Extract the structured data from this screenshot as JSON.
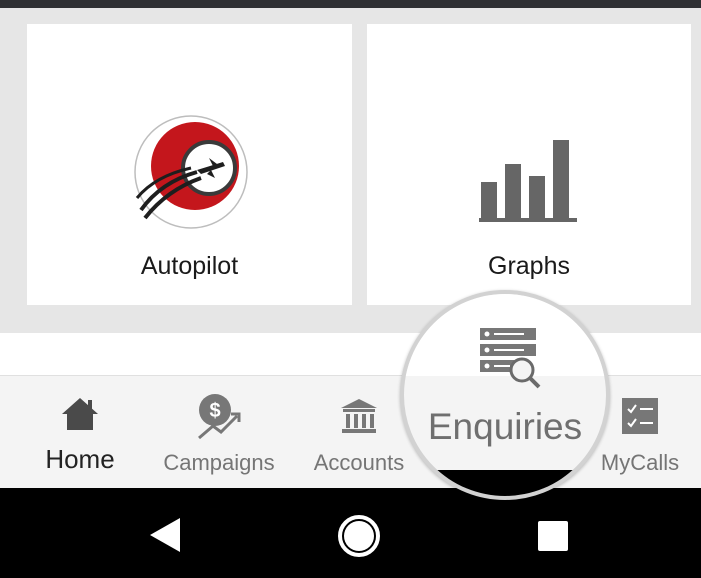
{
  "tiles": [
    {
      "label": "Autopilot",
      "icon": "autopilot-logo-icon"
    },
    {
      "label": "Graphs",
      "icon": "bar-chart-icon"
    }
  ],
  "bottom_nav": {
    "active": "Home",
    "items": [
      {
        "label": "Home",
        "icon": "home-icon"
      },
      {
        "label": "Campaigns",
        "icon": "dollar-growth-icon"
      },
      {
        "label": "Accounts",
        "icon": "bank-icon"
      },
      {
        "label": "Enquiries",
        "icon": "enquiry-search-icon"
      },
      {
        "label": "MyCalls",
        "icon": "checklist-icon"
      }
    ]
  },
  "colors": {
    "accent_red": "#c4161c",
    "icon_gray": "#666666",
    "label_gray": "#757575",
    "active_text": "#222222"
  },
  "system_nav": [
    "back-icon",
    "home-circle-icon",
    "recents-icon"
  ]
}
